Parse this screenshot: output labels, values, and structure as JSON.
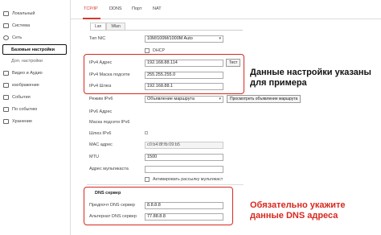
{
  "sidebar": {
    "items": [
      {
        "label": "Локальный"
      },
      {
        "label": "Система"
      },
      {
        "label": "Сеть"
      },
      {
        "label": "Базовые настройки"
      },
      {
        "label": "Доп. настройки"
      },
      {
        "label": "Видео и Аудио"
      },
      {
        "label": "изображение"
      },
      {
        "label": "События"
      },
      {
        "label": "По событию"
      },
      {
        "label": "Хранение"
      }
    ]
  },
  "tabs": [
    "TCP/IP",
    "DDNS",
    "Порт",
    "NAT"
  ],
  "subtabs": [
    "Lan",
    "Wlan"
  ],
  "form": {
    "nic_label": "Тип NIC",
    "nic_value": "10M/100M/1000M Auto",
    "dhcp_label": "DHCP",
    "ipv4_label": "IPv4 Адрес",
    "ipv4_value": "192.168.88.114",
    "test_button": "Тест",
    "mask_label": "IPv4 Маска подсети",
    "mask_value": "255.255.255.0",
    "gw_label": "IPv4 Шлюз",
    "gw_value": "192.168.88.1",
    "ipv6_mode_label": "Режим IPv6",
    "ipv6_mode_value": "Объявление маршрута",
    "route_button": "Просмотреть объявление маршрута",
    "ipv6_addr_label": "IPv6 Адрес",
    "ipv6_mask_label": "Маска подсети IPv6",
    "ipv6_gw_label": "Шлюз IPv6",
    "mac_label": "MAC адрес",
    "mac_value": "c0:b4:8f:fb:09:b5",
    "mtu_label": "MTU",
    "mtu_value": "1500",
    "multicast_label": "Адрес мультикаста",
    "multicast_chk_label": "Активировать рассылку мультикаст",
    "dns_title": "DNS сервер",
    "dns1_label": "Предпочт DNS сервер",
    "dns1_value": "8.8.8.8",
    "dns2_label": "Альтернат DNS сервер",
    "dns2_value": "77.88.8.8"
  },
  "annotations": {
    "network_note": "Данные настройки указаны для примера",
    "dns_note": "Обязательно укажите данные DNS адреса"
  },
  "colors": {
    "accent": "#d23a2f",
    "highlight_box": "#d8281e"
  }
}
